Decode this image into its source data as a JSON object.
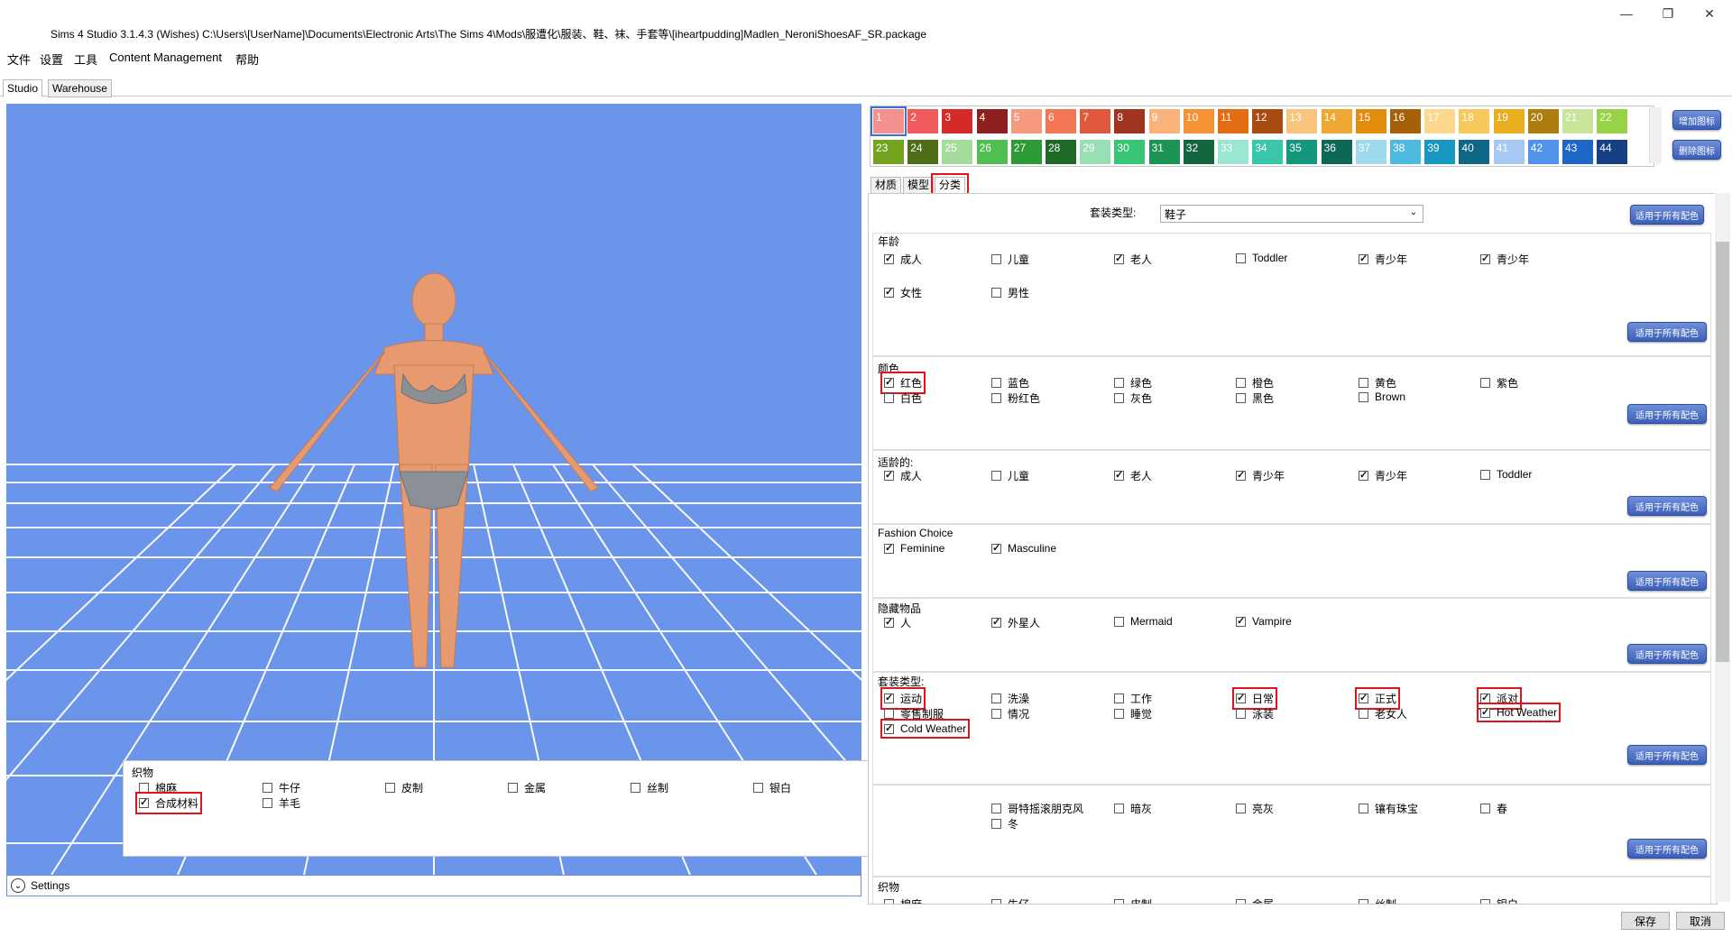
{
  "window": {
    "title": "Sims 4 Studio 3.1.4.3 (Wishes)  C:\\Users\\[UserName]\\Documents\\Electronic Arts\\The Sims 4\\Mods\\服遭化\\服装、鞋、袜、手套等\\[iheartpudding]Madlen_NeroniShoesAF_SR.package",
    "minimize": "—",
    "restore": "❐",
    "close": "✕"
  },
  "menu": [
    "文件",
    "设置",
    "工具",
    "Content Management",
    "帮助"
  ],
  "tabs": [
    "Studio",
    "Warehouse"
  ],
  "swatches": {
    "row1": [
      {
        "n": "1",
        "c": "#f3918f"
      },
      {
        "n": "2",
        "c": "#f05a5a"
      },
      {
        "n": "3",
        "c": "#d42a2a"
      },
      {
        "n": "4",
        "c": "#8e1f1f"
      },
      {
        "n": "5",
        "c": "#f59a7c"
      },
      {
        "n": "6",
        "c": "#f27654"
      },
      {
        "n": "7",
        "c": "#e0593e"
      },
      {
        "n": "8",
        "c": "#a13421"
      },
      {
        "n": "9",
        "c": "#f8b27a"
      },
      {
        "n": "10",
        "c": "#f59233"
      },
      {
        "n": "11",
        "c": "#e46c12"
      },
      {
        "n": "12",
        "c": "#a94b10"
      },
      {
        "n": "13",
        "c": "#f9c57e"
      },
      {
        "n": "14",
        "c": "#f0a833"
      },
      {
        "n": "15",
        "c": "#e28b0c"
      },
      {
        "n": "16",
        "c": "#a66009"
      },
      {
        "n": "17",
        "c": "#fbd88b"
      },
      {
        "n": "18",
        "c": "#f6c95a"
      },
      {
        "n": "19",
        "c": "#e7ae1d"
      },
      {
        "n": "20",
        "c": "#ad7e0e"
      },
      {
        "n": "21",
        "c": "#c9e49b"
      },
      {
        "n": "22",
        "c": "#98d247"
      }
    ],
    "row2": [
      {
        "n": "23",
        "c": "#74a41e"
      },
      {
        "n": "24",
        "c": "#4d6e17"
      },
      {
        "n": "25",
        "c": "#a4dd9b"
      },
      {
        "n": "26",
        "c": "#4fbf52"
      },
      {
        "n": "27",
        "c": "#2d9a35"
      },
      {
        "n": "28",
        "c": "#1f6a27"
      },
      {
        "n": "29",
        "c": "#97e0b4"
      },
      {
        "n": "30",
        "c": "#38c576"
      },
      {
        "n": "31",
        "c": "#1b9456"
      },
      {
        "n": "32",
        "c": "#14663e"
      },
      {
        "n": "33",
        "c": "#9be5d3"
      },
      {
        "n": "34",
        "c": "#38c7a8"
      },
      {
        "n": "35",
        "c": "#14977c"
      },
      {
        "n": "36",
        "c": "#0e6857"
      },
      {
        "n": "37",
        "c": "#9ed9ec"
      },
      {
        "n": "38",
        "c": "#4dbbe0"
      },
      {
        "n": "39",
        "c": "#1797c2"
      },
      {
        "n": "40",
        "c": "#0f6687"
      },
      {
        "n": "41",
        "c": "#a7c8f3"
      },
      {
        "n": "42",
        "c": "#4f93ea"
      },
      {
        "n": "43",
        "c": "#1f66c9"
      },
      {
        "n": "44",
        "c": "#163f84"
      }
    ],
    "add_btn": "增加图标",
    "del_btn": "删除图标"
  },
  "subtabs": [
    "材质",
    "模型",
    "分类"
  ],
  "outfit_type_label": "套装类型:",
  "outfit_type_value": "鞋子",
  "apply_label": "适用于所有配色",
  "sections": {
    "age": {
      "title": "年龄",
      "items": [
        {
          "label": "成人",
          "checked": true
        },
        {
          "label": "儿童",
          "checked": false
        },
        {
          "label": "老人",
          "checked": true
        },
        {
          "label": "Toddler",
          "checked": false
        },
        {
          "label": "青少年",
          "checked": true
        },
        {
          "label": "青少年",
          "checked": true
        },
        {
          "label": "女性",
          "checked": true
        },
        {
          "label": "男性",
          "checked": false
        }
      ]
    },
    "color": {
      "title": "颜色",
      "items": [
        {
          "label": "红色",
          "checked": true
        },
        {
          "label": "蓝色",
          "checked": false
        },
        {
          "label": "绿色",
          "checked": false
        },
        {
          "label": "橙色",
          "checked": false
        },
        {
          "label": "黄色",
          "checked": false
        },
        {
          "label": "紫色",
          "checked": false
        },
        {
          "label": "白色",
          "checked": false
        },
        {
          "label": "粉红色",
          "checked": false
        },
        {
          "label": "灰色",
          "checked": false
        },
        {
          "label": "黑色",
          "checked": false
        },
        {
          "label": "Brown",
          "checked": false
        }
      ]
    },
    "suitable": {
      "title": "适龄的:",
      "items": [
        {
          "label": "成人",
          "checked": true
        },
        {
          "label": "儿童",
          "checked": false
        },
        {
          "label": "老人",
          "checked": true
        },
        {
          "label": "青少年",
          "checked": true
        },
        {
          "label": "青少年",
          "checked": true
        },
        {
          "label": "Toddler",
          "checked": false
        }
      ]
    },
    "fashion": {
      "title": "Fashion Choice",
      "items": [
        {
          "label": "Feminine",
          "checked": true
        },
        {
          "label": "Masculine",
          "checked": true
        }
      ]
    },
    "hidden": {
      "title": "隐藏物品",
      "items": [
        {
          "label": "人",
          "checked": true
        },
        {
          "label": "外星人",
          "checked": true
        },
        {
          "label": "Mermaid",
          "checked": false
        },
        {
          "label": "Vampire",
          "checked": true
        }
      ]
    },
    "outfit": {
      "title": "套装类型:",
      "items": [
        {
          "label": "运动",
          "checked": true
        },
        {
          "label": "洗澡",
          "checked": false
        },
        {
          "label": "工作",
          "checked": false
        },
        {
          "label": "日常",
          "checked": true
        },
        {
          "label": "正式",
          "checked": true
        },
        {
          "label": "派对",
          "checked": true
        },
        {
          "label": "零售制服",
          "checked": false
        },
        {
          "label": "情况",
          "checked": false
        },
        {
          "label": "睡觉",
          "checked": false
        },
        {
          "label": "泳装",
          "checked": false
        },
        {
          "label": "老女人",
          "checked": false
        },
        {
          "label": "Hot Weather",
          "checked": true
        },
        {
          "label": "Cold Weather",
          "checked": true
        }
      ]
    },
    "style": {
      "items": [
        {
          "label": "哥特摇滚朋克风",
          "checked": false
        },
        {
          "label": "暗灰",
          "checked": false
        },
        {
          "label": "亮灰",
          "checked": false
        },
        {
          "label": "镶有珠宝",
          "checked": false
        },
        {
          "label": "春",
          "checked": false
        },
        {
          "label": "冬",
          "checked": false
        }
      ]
    },
    "fabric_bottom": {
      "title": "织物",
      "items": [
        {
          "label": "棉麻"
        },
        {
          "label": "牛仔"
        },
        {
          "label": "皮制"
        },
        {
          "label": "金属"
        },
        {
          "label": "丝制"
        },
        {
          "label": "银白"
        }
      ]
    }
  },
  "fabric_popup": {
    "title": "织物",
    "items": [
      {
        "label": "棉麻",
        "checked": false
      },
      {
        "label": "牛仔",
        "checked": false
      },
      {
        "label": "皮制",
        "checked": false
      },
      {
        "label": "金属",
        "checked": false
      },
      {
        "label": "丝制",
        "checked": false
      },
      {
        "label": "银白",
        "checked": false
      },
      {
        "label": "合成材料",
        "checked": true
      },
      {
        "label": "羊毛",
        "checked": false
      }
    ]
  },
  "settings_label": "Settings",
  "footer": {
    "save": "保存",
    "cancel": "取消"
  }
}
